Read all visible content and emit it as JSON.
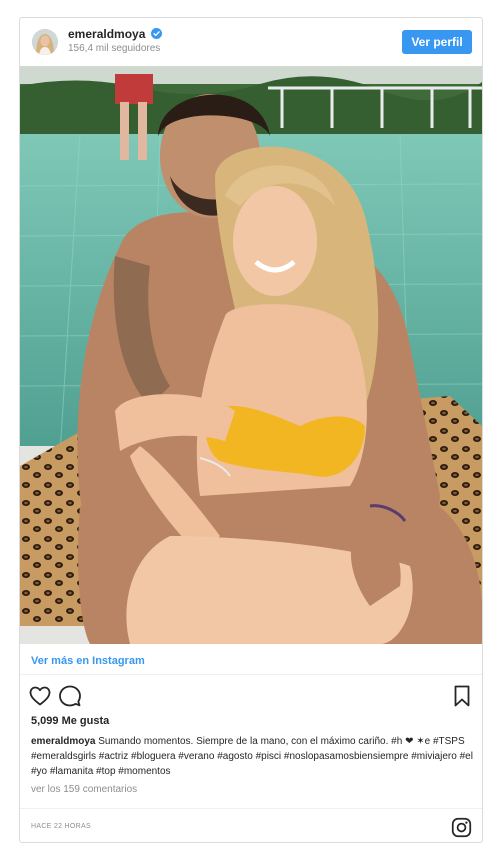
{
  "post": {
    "username": "emeraldmoya",
    "followers": "156,4 mil seguidores",
    "view_profile": "Ver perfil",
    "view_more": "Ver más en Instagram",
    "likes": "5,099 Me gusta",
    "caption_user": "emeraldmoya",
    "caption_text": " Sumando momentos. Siempre de la mano, con el máximo cariño. #h ❤ ✶e #TSPS #emeraldsgirls #actriz #bloguera #verano #agosto #pisci #noslopasamosbiensiempre #miviajero #el #yo #lamanita #top #momentos",
    "comments": "ver los 159 comentarios",
    "time": "HACE 22 HORAS"
  },
  "icons": {
    "verified": "verified-badge-icon",
    "like": "heart-icon",
    "comment": "comment-icon",
    "save": "bookmark-icon",
    "instagram": "instagram-logo-icon"
  },
  "colors": {
    "accent": "#3897f0",
    "text": "#262626",
    "muted": "#8e8e8e",
    "border": "#dbdbdb"
  }
}
